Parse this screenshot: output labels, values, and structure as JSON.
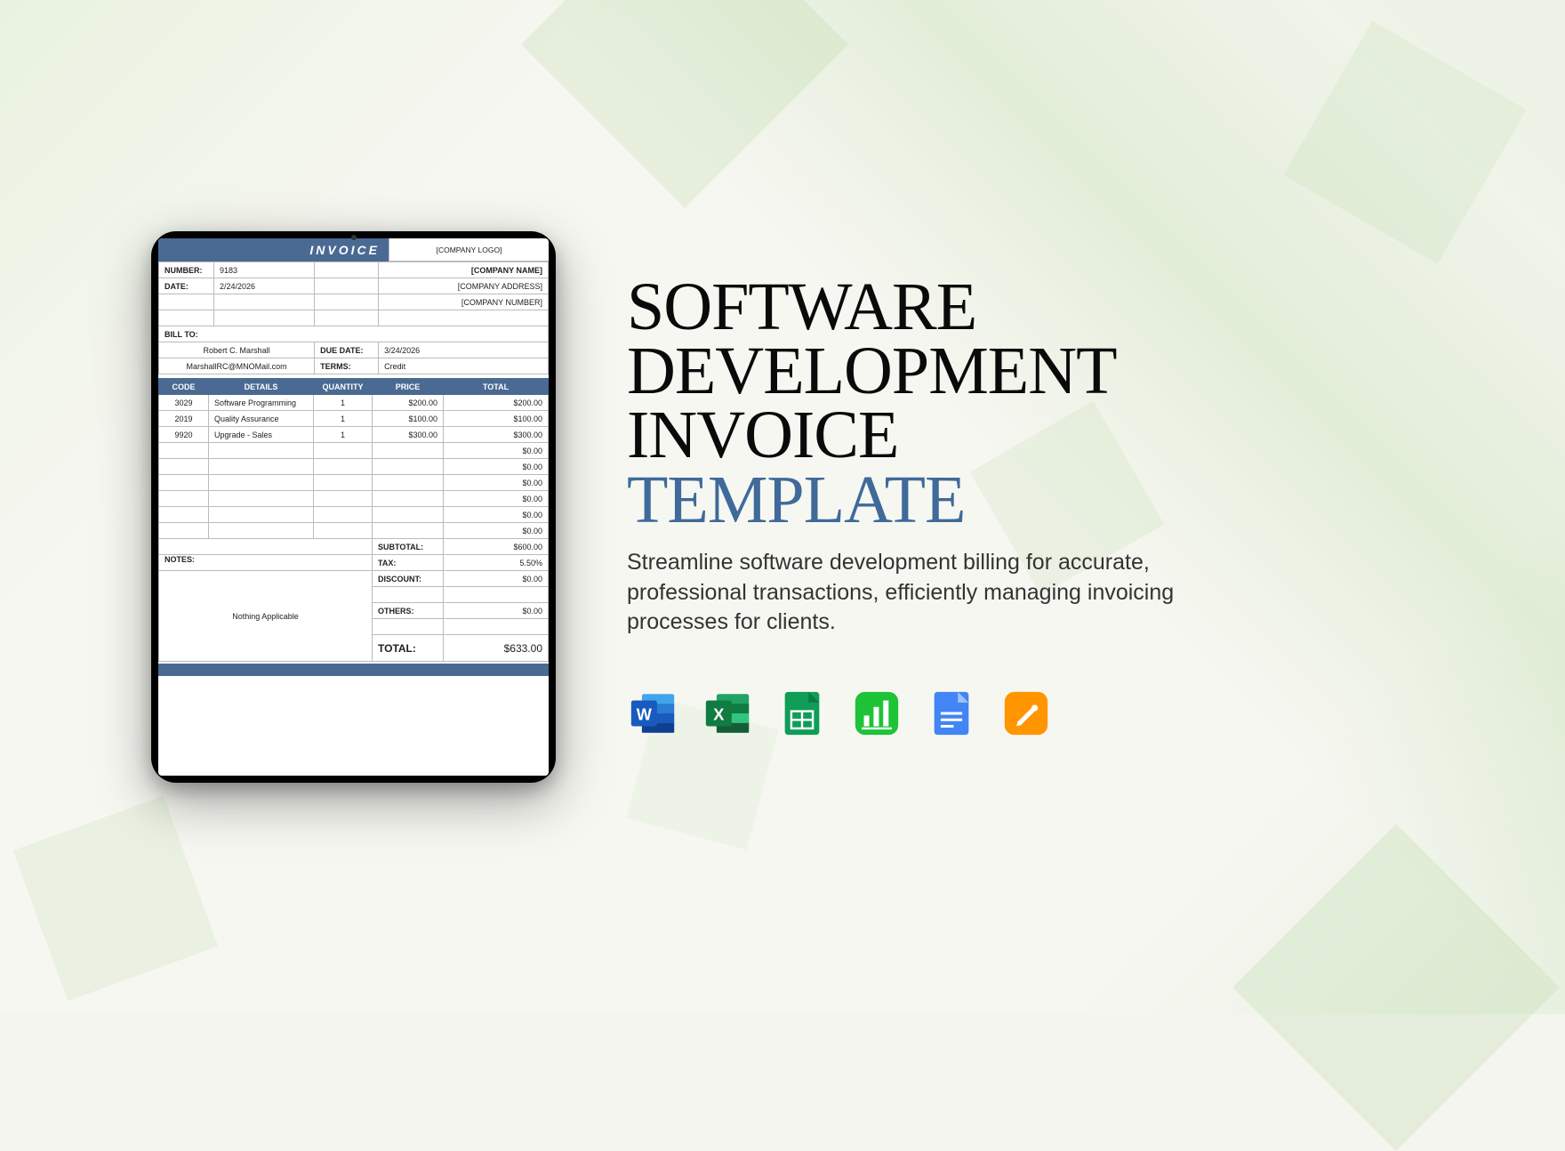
{
  "marketing": {
    "title_line1": "SOFTWARE",
    "title_line2": "DEVELOPMENT",
    "title_line3": "INVOICE",
    "title_accent": "TEMPLATE",
    "description": "Streamline software development billing for accurate, professional transactions, efficiently managing invoicing processes for clients.",
    "app_icons": [
      "word",
      "excel",
      "google-sheets",
      "numbers",
      "google-docs",
      "pages"
    ]
  },
  "invoice": {
    "header_title": "INVOICE",
    "company_logo_placeholder": "[COMPANY LOGO]",
    "company_name_placeholder": "[COMPANY NAME]",
    "company_address_placeholder": "[COMPANY ADDRESS]",
    "company_number_placeholder": "[COMPANY NUMBER]",
    "labels": {
      "number": "NUMBER:",
      "date": "DATE:",
      "bill_to": "BILL TO:",
      "due_date": "DUE DATE:",
      "terms": "TERMS:",
      "subtotal": "SUBTOTAL:",
      "tax": "TAX:",
      "discount": "DISCOUNT:",
      "others": "OTHERS:",
      "total": "TOTAL:",
      "notes": "NOTES:"
    },
    "number": "9183",
    "date": "2/24/2026",
    "bill_to_name": "Robert C. Marshall",
    "bill_to_email": "MarshallRC@MNOMail.com",
    "due_date": "3/24/2026",
    "terms": "Credit",
    "columns": [
      "CODE",
      "DETAILS",
      "QUANTITY",
      "PRICE",
      "TOTAL"
    ],
    "line_items": [
      {
        "code": "3029",
        "details": "Software Programming",
        "quantity": "1",
        "price": "$200.00",
        "total": "$200.00"
      },
      {
        "code": "2019",
        "details": "Quality Assurance",
        "quantity": "1",
        "price": "$100.00",
        "total": "$100.00"
      },
      {
        "code": "9920",
        "details": "Upgrade - Sales",
        "quantity": "1",
        "price": "$300.00",
        "total": "$300.00"
      }
    ],
    "empty_row_totals": [
      "$0.00",
      "$0.00",
      "$0.00",
      "$0.00",
      "$0.00",
      "$0.00"
    ],
    "subtotal": "$600.00",
    "tax": "5.50%",
    "discount": "$0.00",
    "others": "$0.00",
    "total": "$633.00",
    "notes_text": "Nothing Applicable"
  },
  "colors": {
    "accent_blue": "#4a6a93",
    "title_accent": "#3f6a9a"
  }
}
